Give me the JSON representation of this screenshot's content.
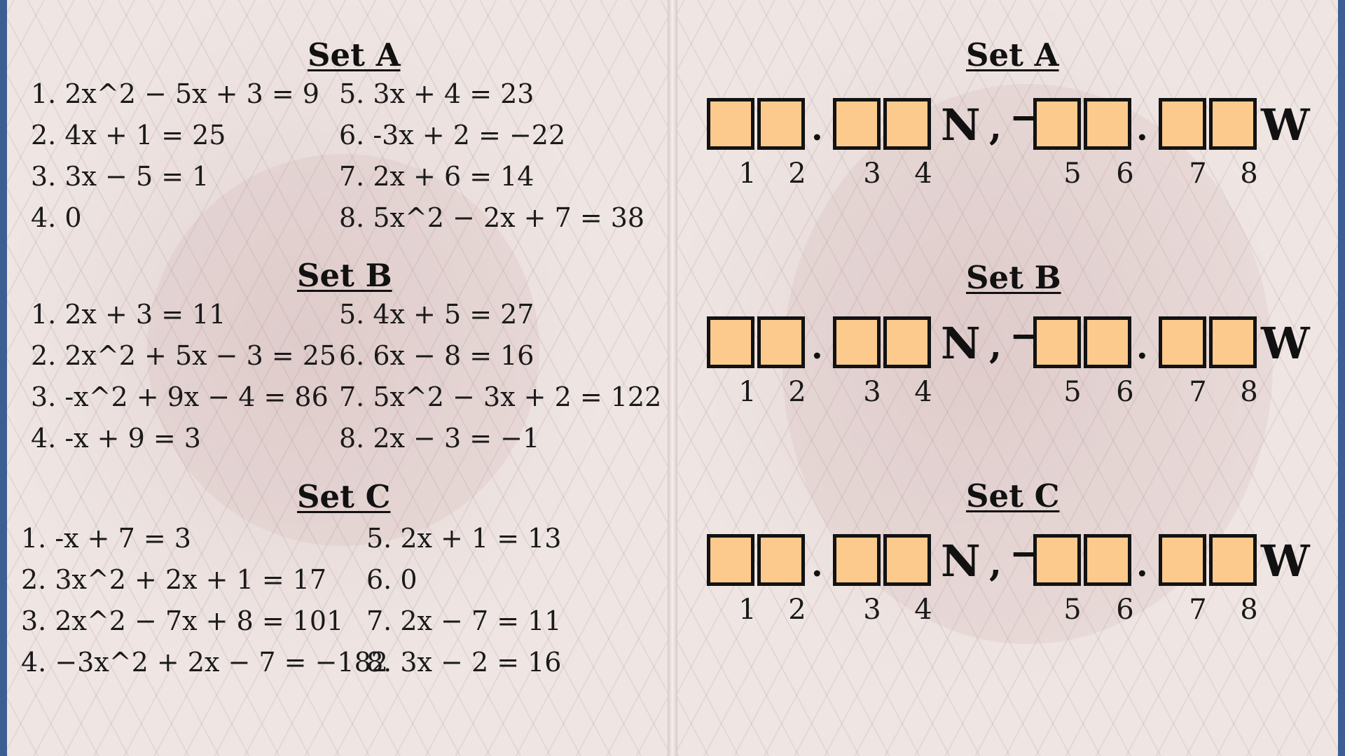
{
  "worksheet": {
    "sets": [
      {
        "title": "Set A",
        "equations": [
          "1. 2x^2 − 5x + 3 = 9",
          "2. 4x + 1 = 25",
          "3. 3x − 5 = 1",
          "4. 0",
          "5. 3x + 4 = 23",
          "6. -3x + 2 = −22",
          "7. 2x + 6 = 14",
          "8. 5x^2 − 2x + 7 = 38"
        ]
      },
      {
        "title": "Set B",
        "equations": [
          "1. 2x + 3 = 11",
          "2. 2x^2 + 5x − 3 = 25",
          "3. -x^2 + 9x − 4 = 86",
          "4. -x + 9 = 3",
          "5. 4x + 5 = 27",
          "6. 6x − 8 = 16",
          "7. 5x^2 − 3x + 2 = 122",
          "8. 2x − 3 = −1"
        ]
      },
      {
        "title": "Set C",
        "equations": [
          "1. -x + 7 = 3",
          "2. 3x^2 + 2x + 1 = 17",
          "3. 2x^2 − 7x + 8 = 101",
          "4. −3x^2 + 2x − 7 = −182",
          "5. 2x + 1 = 13",
          "6. 0",
          "7. 2x − 7 = 11",
          "8. 3x − 2 = 16"
        ]
      }
    ]
  },
  "coordinates": {
    "titles": [
      "Set A",
      "Set B",
      "Set C"
    ],
    "dot": ".",
    "north": "N",
    "comma": ",",
    "minus": "−",
    "west": "W",
    "numbers": [
      "1",
      "2",
      "3",
      "4",
      "5",
      "6",
      "7",
      "8"
    ]
  },
  "colors": {
    "answer_box": "#fbca8c",
    "background_border": "#3b5f93",
    "page": "#efe6e4"
  }
}
